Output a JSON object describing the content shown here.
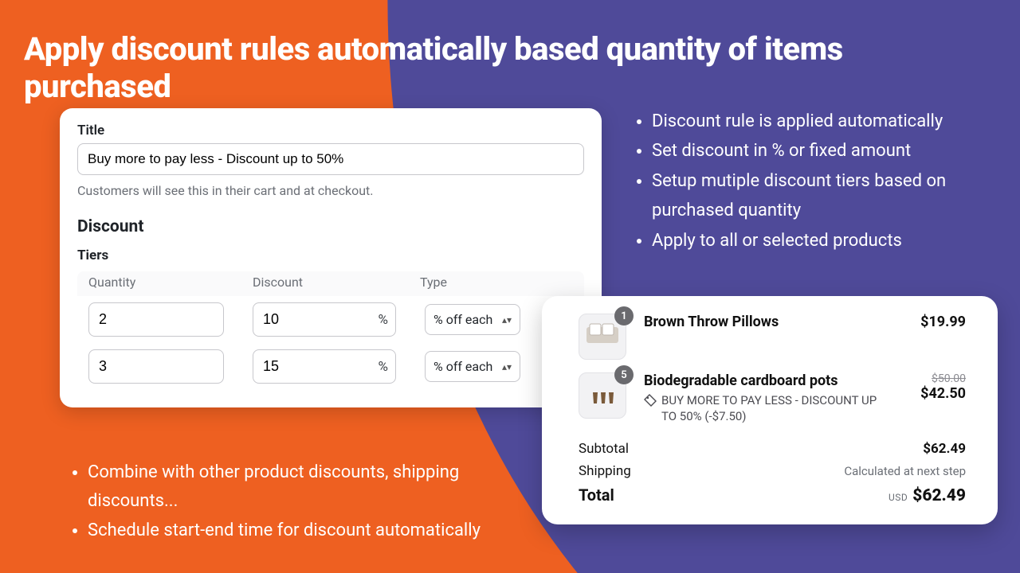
{
  "headline": "Apply discount rules automatically based quantity of items purchased",
  "admin": {
    "title_label": "Title",
    "title_value": "Buy more to pay less - Discount up to 50%",
    "title_hint": "Customers will see this in their cart and at checkout.",
    "discount_heading": "Discount",
    "tiers_heading": "Tiers",
    "col_quantity": "Quantity",
    "col_discount": "Discount",
    "col_type": "Type",
    "pct_symbol": "%",
    "tiers": [
      {
        "qty": "2",
        "disc": "10",
        "type_label": "% off each"
      },
      {
        "qty": "3",
        "disc": "15",
        "type_label": "% off each"
      }
    ]
  },
  "bullets_right": [
    "Discount rule is applied automatically",
    "Set discount in % or fixed amount",
    "Setup mutiple discount tiers based on purchased quantity",
    "Apply to all or selected products"
  ],
  "bullets_bl": [
    "Combine with other product discounts, shipping discounts...",
    "Schedule start-end time for discount automatically"
  ],
  "cart": {
    "items": [
      {
        "qty_badge": "1",
        "name": "Brown Throw Pillows",
        "price": "$19.99",
        "orig": null,
        "promo": null
      },
      {
        "qty_badge": "5",
        "name": "Biodegradable cardboard pots",
        "price": "$42.50",
        "orig": "$50.00",
        "promo": "BUY MORE TO PAY LESS - DISCOUNT UP TO 50% (-$7.50)"
      }
    ],
    "subtotal_label": "Subtotal",
    "subtotal": "$62.49",
    "shipping_label": "Shipping",
    "shipping_value": "Calculated at next step",
    "total_label": "Total",
    "total_currency": "USD",
    "total": "$62.49"
  }
}
